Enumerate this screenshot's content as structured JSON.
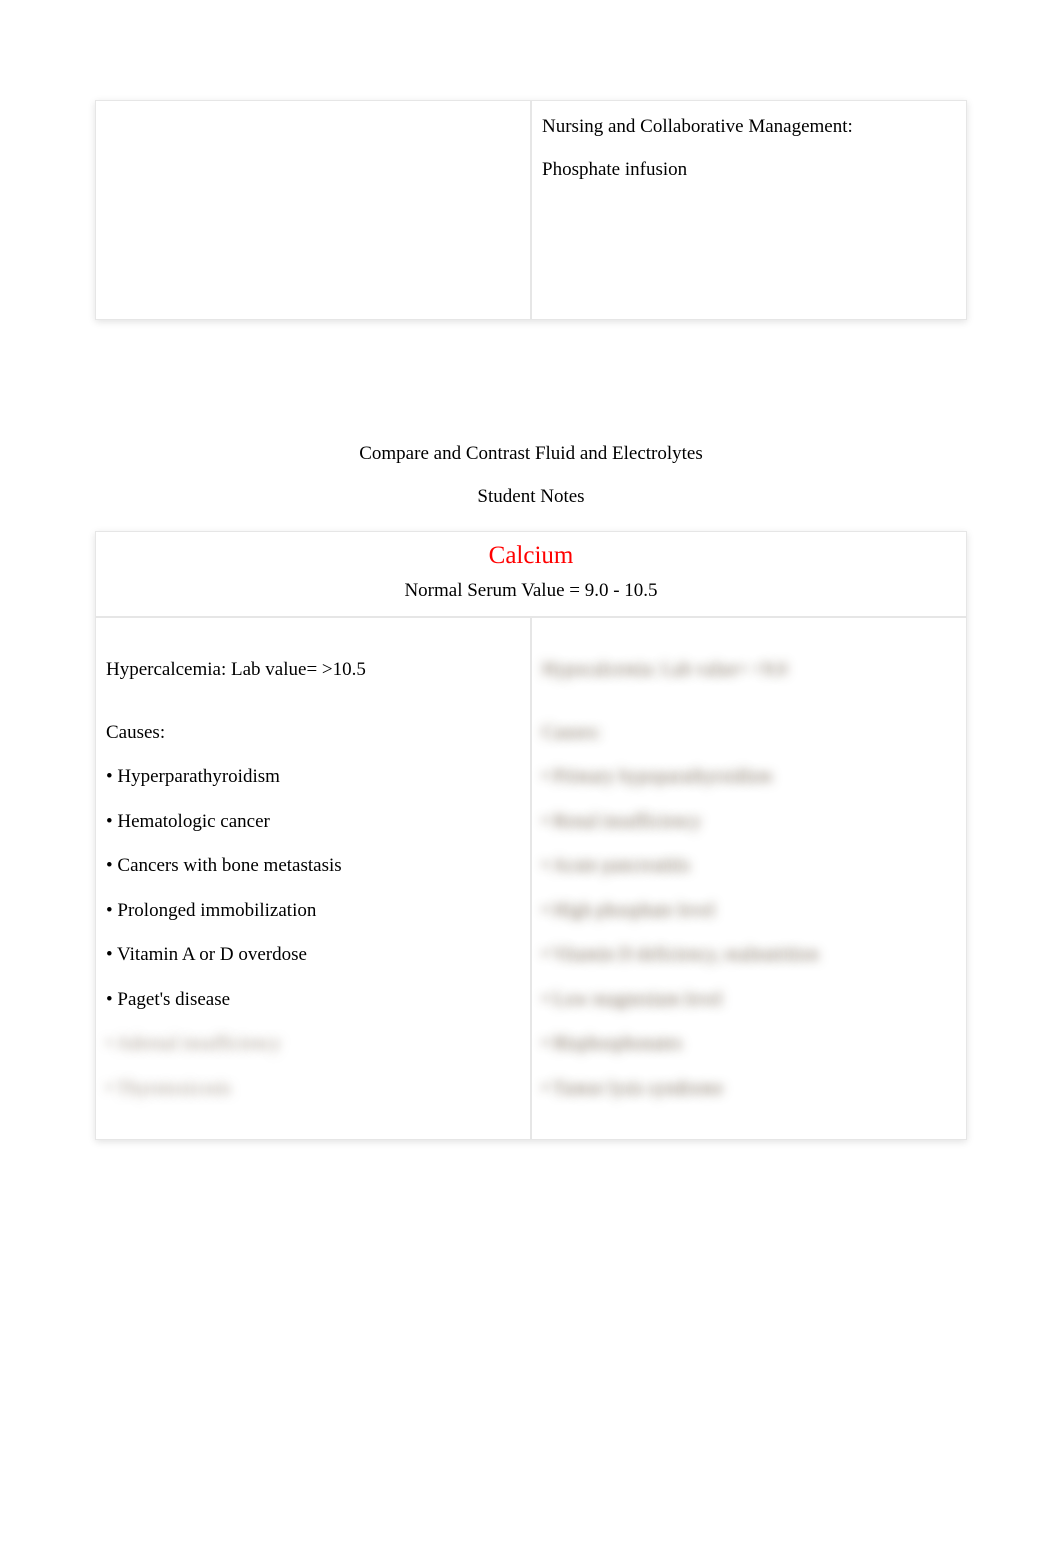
{
  "top_table": {
    "left": "",
    "right": {
      "heading": "Nursing and Collaborative Management:",
      "body": "Phosphate infusion"
    }
  },
  "mid_headings": {
    "line1": "Compare and Contrast Fluid and Electrolytes",
    "line2": "Student Notes"
  },
  "calcium_table": {
    "title": "Calcium",
    "normal_serum": "Normal Serum Value = 9.0 - 10.5",
    "left": {
      "lab": "Hypercalcemia: Lab value= >10.5",
      "causes_label": "Causes:",
      "items": [
        "• Hyperparathyroidism",
        "• Hematologic cancer",
        "• Cancers with bone metastasis",
        "• Prolonged immobilization",
        "• Vitamin A or D overdose",
        "• Paget's disease"
      ],
      "blurred_items": [
        "• Adrenal insufficiency",
        "• Thyrotoxicosis"
      ]
    },
    "right": {
      "lab": "Hypocalcemia: Lab value= <9.0",
      "causes_label": "Causes:",
      "items": [
        "• Primary hypoparathyroidism",
        "• Renal insufficiency",
        "• Acute pancreatitis",
        "• High phosphate level",
        "• Vitamin D deficiency, malnutrition",
        "• Low magnesium level",
        "• Bisphosphonates",
        "• Tumor lysis syndrome"
      ]
    }
  }
}
